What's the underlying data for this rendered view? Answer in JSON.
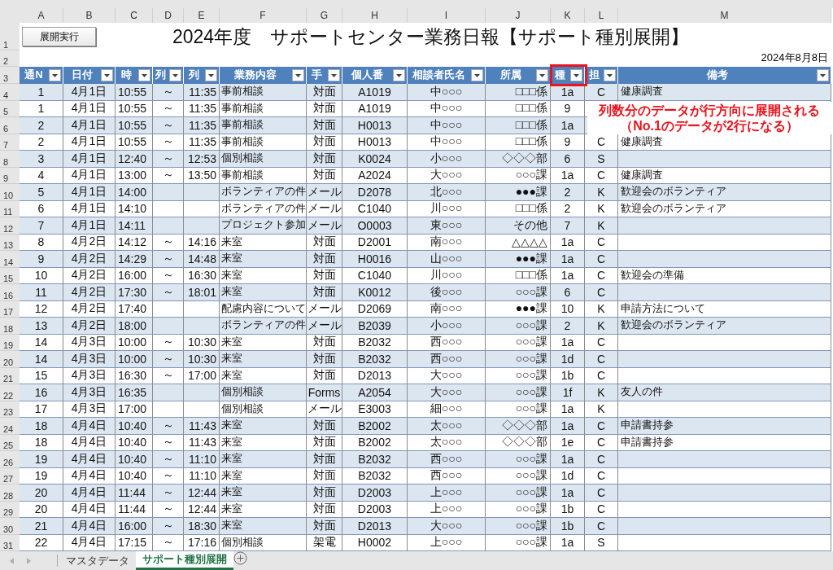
{
  "sheet": {
    "column_letters": [
      "A",
      "B",
      "C",
      "D",
      "E",
      "F",
      "G",
      "H",
      "I",
      "J",
      "K",
      "L",
      "M"
    ],
    "row_numbers": [
      "1",
      "2",
      "3",
      "4",
      "5",
      "6",
      "7",
      "8",
      "9",
      "10",
      "11",
      "12",
      "13",
      "14",
      "15",
      "16",
      "17",
      "18",
      "19",
      "20",
      "21",
      "22",
      "23",
      "24",
      "25",
      "26",
      "27",
      "28",
      "29",
      "30",
      "31"
    ],
    "button": "展開実行",
    "title": "2024年度　サポートセンター業務日報【サポート種別展開】",
    "date": "2024年8月8日",
    "header": [
      "通N",
      "日付",
      "時",
      "列",
      "列",
      "業務内容",
      "手",
      "個人番",
      "相談者氏名",
      "所属",
      "種",
      "担",
      "備考"
    ],
    "rows": [
      [
        "1",
        "4月1日",
        "10:55",
        "～",
        "11:35",
        "事前相談",
        "対面",
        "A1019",
        "中○○○",
        "□□□係",
        "1a",
        "C",
        "健康調査"
      ],
      [
        "1",
        "4月1日",
        "10:55",
        "～",
        "11:35",
        "事前相談",
        "対面",
        "A1019",
        "中○○○",
        "□□□係",
        "9",
        null,
        null
      ],
      [
        "2",
        "4月1日",
        "10:55",
        "～",
        "11:35",
        "事前相談",
        "対面",
        "H0013",
        "中○○○",
        "□□□係",
        "1a",
        null,
        null
      ],
      [
        "2",
        "4月1日",
        "10:55",
        "～",
        "11:35",
        "事前相談",
        "対面",
        "H0013",
        "中○○○",
        "□□□係",
        "9",
        "C",
        "健康調査"
      ],
      [
        "3",
        "4月1日",
        "12:40",
        "～",
        "12:53",
        "個別相談",
        "対面",
        "K0024",
        "小○○○",
        "◇◇◇部",
        "6",
        "S",
        null
      ],
      [
        "4",
        "4月1日",
        "13:00",
        "～",
        "13:50",
        "事前相談",
        "対面",
        "A2024",
        "大○○○",
        "○○○課",
        "1a",
        "C",
        "健康調査"
      ],
      [
        "5",
        "4月1日",
        "14:00",
        null,
        null,
        "ボランティアの件",
        "メール",
        "D2078",
        "北○○○",
        "●●●課",
        "2",
        "K",
        "歓迎会のボランティア"
      ],
      [
        "6",
        "4月1日",
        "14:10",
        null,
        null,
        "ボランティアの件",
        "メール",
        "C1040",
        "川○○○",
        "□□□係",
        "2",
        "K",
        "歓迎会のボランティア"
      ],
      [
        "7",
        "4月1日",
        "14:11",
        null,
        null,
        "プロジェクト参加",
        "メール",
        "O0003",
        "東○○○",
        "その他",
        "7",
        "K",
        null
      ],
      [
        "8",
        "4月2日",
        "14:12",
        "～",
        "14:16",
        "来室",
        "対面",
        "D2001",
        "南○○○",
        "△△△△",
        "1a",
        "C",
        null
      ],
      [
        "9",
        "4月2日",
        "14:29",
        "～",
        "14:48",
        "来室",
        "対面",
        "H0016",
        "山○○○",
        "●●●課",
        "1a",
        "C",
        null
      ],
      [
        "10",
        "4月2日",
        "16:00",
        "～",
        "16:30",
        "来室",
        "対面",
        "C1040",
        "川○○○",
        "□□□係",
        "1a",
        "C",
        "歓迎会の準備"
      ],
      [
        "11",
        "4月2日",
        "17:30",
        "～",
        "18:01",
        "来室",
        "対面",
        "K0012",
        "後○○○",
        "○○○課",
        "6",
        "C",
        null
      ],
      [
        "12",
        "4月2日",
        "17:40",
        null,
        null,
        "配慮内容について",
        "メール",
        "D2069",
        "南○○○",
        "●●●課",
        "10",
        "K",
        "申請方法について"
      ],
      [
        "13",
        "4月2日",
        "18:00",
        null,
        null,
        "ボランティアの件",
        "メール",
        "B2039",
        "小○○○",
        "○○○課",
        "2",
        "K",
        "歓迎会のボランティア"
      ],
      [
        "14",
        "4月3日",
        "10:00",
        "～",
        "10:30",
        "来室",
        "対面",
        "B2032",
        "西○○○",
        "○○○課",
        "1a",
        "C",
        null
      ],
      [
        "14",
        "4月3日",
        "10:00",
        "～",
        "10:30",
        "来室",
        "対面",
        "B2032",
        "西○○○",
        "○○○課",
        "1d",
        "C",
        null
      ],
      [
        "15",
        "4月3日",
        "16:30",
        "～",
        "17:00",
        "来室",
        "対面",
        "D2013",
        "大○○○",
        "○○○課",
        "1b",
        "C",
        null
      ],
      [
        "16",
        "4月3日",
        "16:35",
        null,
        null,
        "個別相談",
        "Forms",
        "A2054",
        "大○○○",
        "○○○課",
        "1f",
        "K",
        "友人の件"
      ],
      [
        "17",
        "4月3日",
        "17:00",
        null,
        null,
        "個別相談",
        "メール",
        "E3003",
        "細○○○",
        "○○○課",
        "1a",
        "K",
        null
      ],
      [
        "18",
        "4月4日",
        "10:40",
        "～",
        "11:43",
        "来室",
        "対面",
        "B2002",
        "太○○○",
        "◇◇◇部",
        "1a",
        "C",
        "申請書持参"
      ],
      [
        "18",
        "4月4日",
        "10:40",
        "～",
        "11:43",
        "来室",
        "対面",
        "B2002",
        "太○○○",
        "◇◇◇部",
        "1e",
        "C",
        "申請書持参"
      ],
      [
        "19",
        "4月4日",
        "10:40",
        "～",
        "11:10",
        "来室",
        "対面",
        "B2032",
        "西○○○",
        "○○○課",
        "1a",
        "C",
        null
      ],
      [
        "19",
        "4月4日",
        "10:40",
        "～",
        "11:10",
        "来室",
        "対面",
        "B2032",
        "西○○○",
        "○○○課",
        "1d",
        "C",
        null
      ],
      [
        "20",
        "4月4日",
        "11:44",
        "～",
        "12:44",
        "来室",
        "対面",
        "D2003",
        "上○○○",
        "○○○課",
        "1a",
        "C",
        null
      ],
      [
        "20",
        "4月4日",
        "11:44",
        "～",
        "12:44",
        "来室",
        "対面",
        "D2003",
        "上○○○",
        "○○○課",
        "1b",
        "C",
        null
      ],
      [
        "21",
        "4月4日",
        "16:00",
        "～",
        "18:30",
        "来室",
        "対面",
        "D2013",
        "大○○○",
        "○○○課",
        "1b",
        "C",
        null
      ],
      [
        "22",
        "4月4日",
        "17:15",
        "～",
        "17:16",
        "個別相談",
        "架電",
        "H0002",
        "上○○○",
        "○○○課",
        "1a",
        "S",
        null
      ]
    ]
  },
  "annotation": {
    "lines": [
      "列数分のデータが行方向に展開される",
      "（No.1のデータが2行になる）"
    ]
  },
  "sheet_tabs": [
    {
      "label": "マスタデータ",
      "selected": false
    },
    {
      "label": "サポート種別展開",
      "selected": true
    }
  ]
}
